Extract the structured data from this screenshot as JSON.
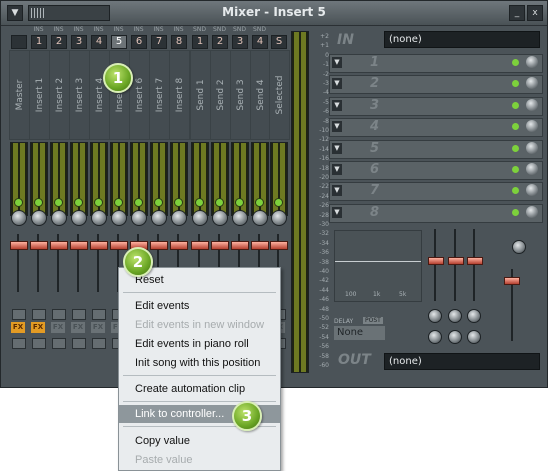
{
  "window": {
    "title": "Mixer - Insert 5",
    "menu_icon": "chevron-down-icon",
    "minimize": "_",
    "close": "x"
  },
  "channels": [
    {
      "tag": "",
      "num": "",
      "label": "Master"
    },
    {
      "tag": "INS",
      "num": "1",
      "label": "Insert 1"
    },
    {
      "tag": "INS",
      "num": "2",
      "label": "Insert 2"
    },
    {
      "tag": "INS",
      "num": "3",
      "label": "Insert 3"
    },
    {
      "tag": "INS",
      "num": "4",
      "label": "Insert 4"
    },
    {
      "tag": "INS",
      "num": "5",
      "label": "Insert 5"
    },
    {
      "tag": "INS",
      "num": "6",
      "label": "Insert 6"
    },
    {
      "tag": "INS",
      "num": "7",
      "label": "Insert 7"
    },
    {
      "tag": "INS",
      "num": "8",
      "label": "Insert 8"
    },
    {
      "tag": "SND",
      "num": "1",
      "label": "Send 1"
    },
    {
      "tag": "SND",
      "num": "2",
      "label": "Send 2"
    },
    {
      "tag": "SND",
      "num": "3",
      "label": "Send 3"
    },
    {
      "tag": "SND",
      "num": "4",
      "label": "Send 4"
    },
    {
      "tag": "",
      "num": "S",
      "label": "Selected"
    }
  ],
  "db_scale": [
    "+2",
    "+1",
    "0",
    "-1",
    "-2",
    "-3",
    "-4",
    "-5",
    "-6",
    "-8",
    "-10",
    "-12",
    "-14",
    "-16",
    "-18",
    "-20",
    "-22",
    "-24",
    "-26",
    "-28",
    "-30",
    "-32",
    "-34",
    "-36",
    "-38",
    "-40",
    "-42",
    "-44",
    "-46",
    "-48",
    "-50",
    "-52",
    "-54",
    "-56",
    "-58",
    "-60"
  ],
  "input": {
    "label": "IN",
    "value": "(none)"
  },
  "fx_slots": [
    "1",
    "2",
    "3",
    "4",
    "5",
    "6",
    "7",
    "8"
  ],
  "eq": {
    "freq_labels": [
      "100",
      "1k",
      "5k"
    ]
  },
  "delay": {
    "label": "DELAY",
    "mode": "POST",
    "value": "None"
  },
  "output": {
    "label": "OUT",
    "value": "(none)"
  },
  "fx_button": "FX",
  "context_menu": {
    "items": [
      {
        "label": "Reset",
        "disabled": false
      },
      {
        "label": "Edit events",
        "disabled": false
      },
      {
        "label": "Edit events in new window",
        "disabled": true
      },
      {
        "label": "Edit events in piano roll",
        "disabled": false
      },
      {
        "label": "Init song with this position",
        "disabled": false
      },
      {
        "label": "Create automation clip",
        "disabled": false
      },
      {
        "label": "Link to controller...",
        "disabled": false,
        "highlighted": true
      },
      {
        "label": "Copy value",
        "disabled": false
      },
      {
        "label": "Paste value",
        "disabled": true
      }
    ]
  },
  "callouts": [
    "1",
    "2",
    "3"
  ]
}
